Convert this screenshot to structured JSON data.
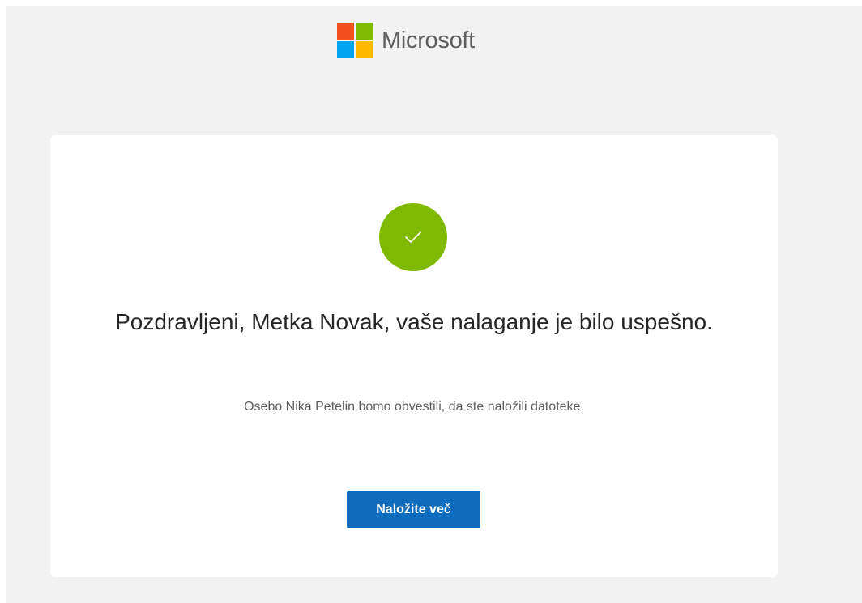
{
  "header": {
    "brand_name": "Microsoft",
    "logo_colors": [
      "#f25022",
      "#7fba00",
      "#00a4ef",
      "#ffb900"
    ]
  },
  "confirmation": {
    "status_icon": "check-icon",
    "status_color": "#7fba00",
    "headline": "Pozdravljeni, Metka Novak, vaše nalaganje je bilo uspešno.",
    "message": "Osebo Nika Petelin bomo obvestili, da ste naložili datoteke.",
    "button_label": "Naložite več",
    "button_color": "#0f6cbd"
  }
}
